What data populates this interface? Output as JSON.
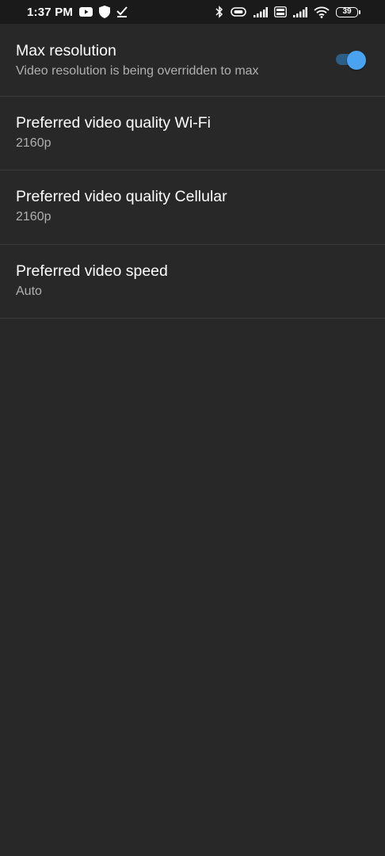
{
  "status_bar": {
    "time": "1:37 PM",
    "battery_level": "39",
    "left_icons": [
      "youtube-icon",
      "shield-icon",
      "check-download-icon"
    ],
    "right_icons": [
      "bluetooth-icon",
      "vibrate-icon",
      "cell-signal-icon",
      "volte-icon",
      "cell-signal-icon",
      "wifi-icon",
      "battery-icon"
    ]
  },
  "settings": {
    "items": [
      {
        "title": "Max resolution",
        "subtitle": "Video resolution is being overridden to max",
        "toggle_on": true
      },
      {
        "title": "Preferred video quality Wi-Fi",
        "subtitle": "2160p"
      },
      {
        "title": "Preferred video quality Cellular",
        "subtitle": "2160p"
      },
      {
        "title": "Preferred video speed",
        "subtitle": "Auto"
      }
    ]
  },
  "colors": {
    "background": "#282828",
    "status_bar": "#1a1a1a",
    "divider": "#3c3c3c",
    "toggle_thumb": "#4aa3f0",
    "toggle_track": "#2c5e86",
    "subtitle": "#b0b0b0"
  }
}
